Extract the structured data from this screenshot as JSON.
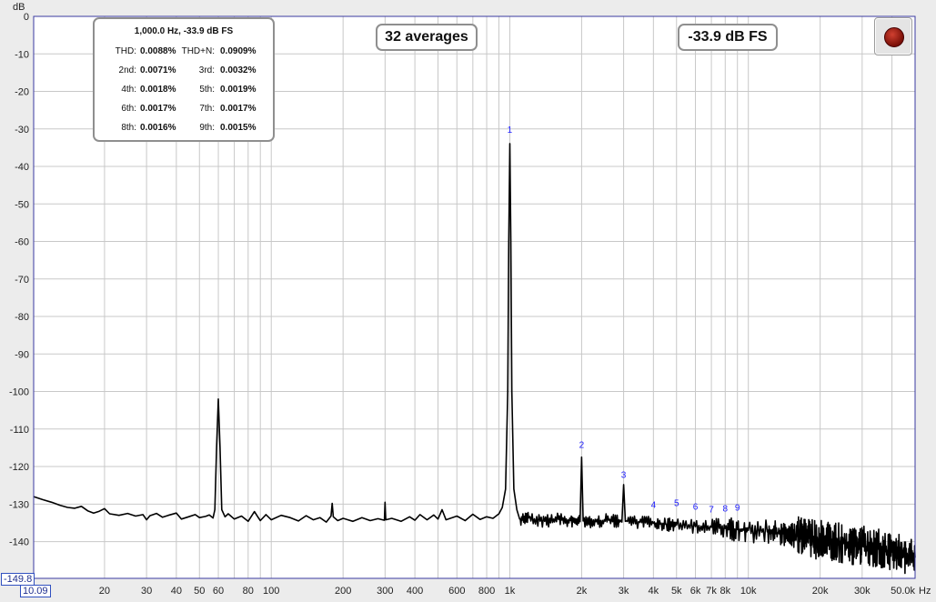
{
  "chart_data": {
    "type": "line",
    "title": "",
    "ylabel": "dB",
    "xlabel": "Hz",
    "x_scale": "log",
    "xlim": [
      10.09,
      50000
    ],
    "ylim": [
      -149.8,
      0
    ],
    "y_ticks": [
      0,
      -10,
      -20,
      -30,
      -40,
      -50,
      -60,
      -70,
      -80,
      -90,
      -100,
      -110,
      -120,
      -130,
      -140
    ],
    "x_ticks": [
      {
        "value": 20,
        "label": "20"
      },
      {
        "value": 30,
        "label": "30"
      },
      {
        "value": 40,
        "label": "40"
      },
      {
        "value": 50,
        "label": "50"
      },
      {
        "value": 60,
        "label": "60"
      },
      {
        "value": 80,
        "label": "80"
      },
      {
        "value": 100,
        "label": "100"
      },
      {
        "value": 200,
        "label": "200"
      },
      {
        "value": 300,
        "label": "300"
      },
      {
        "value": 400,
        "label": "400"
      },
      {
        "value": 600,
        "label": "600"
      },
      {
        "value": 800,
        "label": "800"
      },
      {
        "value": 1000,
        "label": "1k"
      },
      {
        "value": 2000,
        "label": "2k"
      },
      {
        "value": 3000,
        "label": "3k"
      },
      {
        "value": 4000,
        "label": "4k"
      },
      {
        "value": 5000,
        "label": "5k"
      },
      {
        "value": 6000,
        "label": "6k"
      },
      {
        "value": 7000,
        "label": "7k"
      },
      {
        "value": 8000,
        "label": "8k"
      },
      {
        "value": 10000,
        "label": "10k"
      },
      {
        "value": 20000,
        "label": "20k"
      },
      {
        "value": 30000,
        "label": "30k"
      },
      {
        "value": 50000,
        "label": "50.0k"
      }
    ],
    "x_minor_gridlines": [
      70,
      90,
      500,
      700,
      900,
      9000,
      40000
    ],
    "x_min_label": "10.09",
    "y_min_label": "-149.8",
    "grid": true,
    "series": [
      {
        "color": "#000000",
        "points": [
          [
            10.09,
            -128
          ],
          [
            11,
            -128.8
          ],
          [
            12,
            -129.5
          ],
          [
            13,
            -130.3
          ],
          [
            14,
            -130.9
          ],
          [
            15,
            -131.1
          ],
          [
            16,
            -130.6
          ],
          [
            17,
            -131.8
          ],
          [
            18,
            -132.4
          ],
          [
            19,
            -131.9
          ],
          [
            20,
            -131.2
          ],
          [
            21,
            -132.6
          ],
          [
            23,
            -133.0
          ],
          [
            25,
            -132.5
          ],
          [
            27,
            -133.2
          ],
          [
            29,
            -132.8
          ],
          [
            30,
            -134.2
          ],
          [
            31,
            -133.1
          ],
          [
            33,
            -132.5
          ],
          [
            35,
            -133.5
          ],
          [
            37,
            -133.0
          ],
          [
            40,
            -132.4
          ],
          [
            42,
            -134.0
          ],
          [
            45,
            -133.4
          ],
          [
            48,
            -132.8
          ],
          [
            50,
            -133.6
          ],
          [
            53,
            -133.3
          ],
          [
            55,
            -132.9
          ],
          [
            57,
            -133.7
          ],
          [
            58,
            -131.5
          ],
          [
            59,
            -115
          ],
          [
            60,
            -102
          ],
          [
            61,
            -115
          ],
          [
            62,
            -131.5
          ],
          [
            64,
            -133.4
          ],
          [
            66,
            -132.6
          ],
          [
            70,
            -134.0
          ],
          [
            75,
            -133.2
          ],
          [
            80,
            -134.6
          ],
          [
            85,
            -132.0
          ],
          [
            88,
            -133.5
          ],
          [
            90,
            -134.4
          ],
          [
            95,
            -132.8
          ],
          [
            100,
            -134.2
          ],
          [
            110,
            -133.0
          ],
          [
            120,
            -133.6
          ],
          [
            130,
            -134.5
          ],
          [
            140,
            -133.1
          ],
          [
            150,
            -134.2
          ],
          [
            160,
            -133.6
          ],
          [
            170,
            -134.8
          ],
          [
            178,
            -133.2
          ],
          [
            180,
            -129.8
          ],
          [
            182,
            -133.4
          ],
          [
            190,
            -134.4
          ],
          [
            200,
            -133.8
          ],
          [
            220,
            -134.6
          ],
          [
            240,
            -133.6
          ],
          [
            260,
            -134.4
          ],
          [
            280,
            -133.9
          ],
          [
            298,
            -134.3
          ],
          [
            300,
            -129.5
          ],
          [
            302,
            -134.2
          ],
          [
            320,
            -133.8
          ],
          [
            350,
            -134.6
          ],
          [
            380,
            -133.4
          ],
          [
            400,
            -134.3
          ],
          [
            420,
            -132.8
          ],
          [
            450,
            -134.2
          ],
          [
            480,
            -132.9
          ],
          [
            500,
            -134.0
          ],
          [
            520,
            -131.5
          ],
          [
            540,
            -134.2
          ],
          [
            600,
            -133.2
          ],
          [
            650,
            -134.4
          ],
          [
            700,
            -132.7
          ],
          [
            750,
            -134.1
          ],
          [
            800,
            -133.4
          ],
          [
            850,
            -133.8
          ],
          [
            900,
            -132.6
          ],
          [
            930,
            -130.9
          ],
          [
            960,
            -126
          ],
          [
            980,
            -100
          ],
          [
            990,
            -60
          ],
          [
            1000,
            -33.9
          ],
          [
            1010,
            -60
          ],
          [
            1020,
            -100
          ],
          [
            1040,
            -126
          ],
          [
            1070,
            -131.5
          ],
          [
            1100,
            -134.0
          ],
          [
            1200,
            -133.7
          ],
          [
            1400,
            -134.6
          ],
          [
            1600,
            -134.1
          ],
          [
            1800,
            -134.4
          ],
          [
            1970,
            -134.7
          ],
          [
            2000,
            -117.5
          ],
          [
            2030,
            -134.5
          ],
          [
            2300,
            -134.7
          ],
          [
            2600,
            -134.3
          ],
          [
            2950,
            -134.8
          ],
          [
            3000,
            -124.8
          ],
          [
            3050,
            -134.6
          ],
          [
            3500,
            -134.9
          ],
          [
            4000,
            -135.1
          ],
          [
            4500,
            -135.4
          ],
          [
            5000,
            -135.6
          ],
          [
            6000,
            -136.0
          ],
          [
            7000,
            -136.2
          ],
          [
            8000,
            -136.5
          ],
          [
            9000,
            -136.8
          ],
          [
            10000,
            -137.0
          ],
          [
            12000,
            -137.4
          ],
          [
            14000,
            -137.9
          ],
          [
            16000,
            -138.6
          ],
          [
            18000,
            -139.1
          ],
          [
            20000,
            -139.6
          ],
          [
            22000,
            -139.9
          ],
          [
            25000,
            -140.4
          ],
          [
            28000,
            -140.9
          ],
          [
            30000,
            -141.3
          ],
          [
            35000,
            -142.0
          ],
          [
            40000,
            -142.8
          ],
          [
            45000,
            -143.6
          ],
          [
            50000,
            -144.3
          ]
        ]
      }
    ],
    "harmonic_markers": [
      {
        "label": "1",
        "freq": 1000,
        "level": -31
      },
      {
        "label": "2",
        "freq": 2000,
        "level": -115
      },
      {
        "label": "3",
        "freq": 3000,
        "level": -123
      },
      {
        "label": "4",
        "freq": 4000,
        "level": -131
      },
      {
        "label": "5",
        "freq": 5000,
        "level": -130.5
      },
      {
        "label": "6",
        "freq": 6000,
        "level": -131.5
      },
      {
        "label": "7",
        "freq": 7000,
        "level": -132.2
      },
      {
        "label": "8",
        "freq": 8000,
        "level": -132
      },
      {
        "label": "9",
        "freq": 9000,
        "level": -131.7
      }
    ]
  },
  "stats": {
    "title": "1,000.0 Hz, -33.9 dB FS",
    "rows": [
      {
        "l1": "THD:",
        "v1": "0.0088%",
        "l2": "THD+N:",
        "v2": "0.0909%"
      },
      {
        "l1": "2nd:",
        "v1": "0.0071%",
        "l2": "3rd:",
        "v2": "0.0032%"
      },
      {
        "l1": "4th:",
        "v1": "0.0018%",
        "l2": "5th:",
        "v2": "0.0019%"
      },
      {
        "l1": "6th:",
        "v1": "0.0017%",
        "l2": "7th:",
        "v2": "0.0017%"
      },
      {
        "l1": "8th:",
        "v1": "0.0016%",
        "l2": "9th:",
        "v2": "0.0015%"
      }
    ]
  },
  "averages_label": "32 averages",
  "level_label": "-33.9 dB FS",
  "record_button": {
    "icon": "record-icon",
    "color": "#b02a18"
  }
}
